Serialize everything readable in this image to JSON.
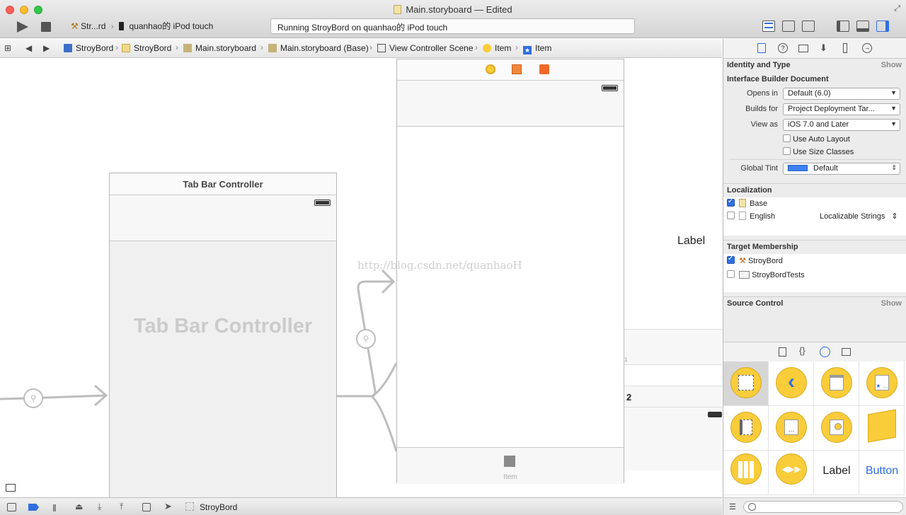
{
  "window": {
    "title": "Main.storyboard — Edited"
  },
  "toolbar": {
    "scheme_target": "Str...rd",
    "scheme_device": "quanhao的 iPod touch",
    "status": "Running StroyBord on quanhao的 iPod touch"
  },
  "jumpbar": {
    "crumbs": [
      "StroyBord",
      "StroyBord",
      "Main.storyboard",
      "Main.storyboard (Base)",
      "View Controller Scene",
      "Item",
      "Item"
    ]
  },
  "canvas": {
    "tab_bar_title": "Tab Bar Controller",
    "tab_bar_placeholder": "Tab Bar Controller",
    "watermark": "http://blog.csdn.net/quanhaoH",
    "right_label": "Label",
    "right_number": "2",
    "right_small": "1",
    "tab_item_label": "Item"
  },
  "inspector": {
    "identity_header": "Identity and Type",
    "show_label": "Show",
    "ib_document": "Interface Builder Document",
    "opens_in_label": "Opens in",
    "opens_in_value": "Default (6.0)",
    "builds_for_label": "Builds for",
    "builds_for_value": "Project Deployment Tar...",
    "view_as_label": "View as",
    "view_as_value": "iOS 7.0 and Later",
    "auto_layout": "Use Auto Layout",
    "size_classes": "Use Size Classes",
    "global_tint_label": "Global Tint",
    "global_tint_value": "Default",
    "global_tint_color": "#3b82f6",
    "localization_header": "Localization",
    "loc_base": "Base",
    "loc_english": "English",
    "loc_english_type": "Localizable Strings",
    "target_header": "Target Membership",
    "target_main": "StroyBord",
    "target_tests": "StroyBordTests",
    "source_header": "Source Control",
    "source_show": "Show"
  },
  "library": {
    "label_item": "Label",
    "button_item": "Button"
  },
  "bottombar": {
    "target": "StroyBord"
  }
}
